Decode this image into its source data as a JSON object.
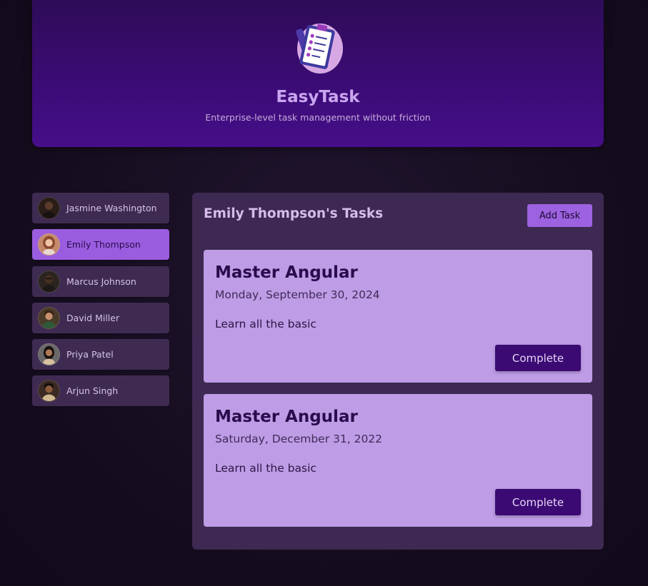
{
  "header": {
    "title": "EasyTask",
    "subtitle": "Enterprise-level task management without friction",
    "logo_icon": "task-list-clipboard-icon"
  },
  "users": [
    {
      "name": "Jasmine Washington",
      "selected": false,
      "avatar_color": "#2a1d18"
    },
    {
      "name": "Emily Thompson",
      "selected": true,
      "avatar_color": "#c48a6a"
    },
    {
      "name": "Marcus Johnson",
      "selected": false,
      "avatar_color": "#2b2420"
    },
    {
      "name": "David Miller",
      "selected": false,
      "avatar_color": "#4a3a28"
    },
    {
      "name": "Priya Patel",
      "selected": false,
      "avatar_color": "#6a6868"
    },
    {
      "name": "Arjun Singh",
      "selected": false,
      "avatar_color": "#3b2a24"
    }
  ],
  "tasks_panel": {
    "title": "Emily Thompson's Tasks",
    "add_task_label": "Add Task"
  },
  "tasks": [
    {
      "title": "Master Angular",
      "date": "Monday, September 30, 2024",
      "description": "Learn all the basic",
      "complete_label": "Complete"
    },
    {
      "title": "Master Angular",
      "date": "Saturday, December 31, 2022",
      "description": "Learn all the basic",
      "complete_label": "Complete"
    }
  ],
  "colors": {
    "accent": "#9c62e0",
    "header": "#3b0c74",
    "card": "#bf9ce6",
    "button": "#3b0a73"
  }
}
